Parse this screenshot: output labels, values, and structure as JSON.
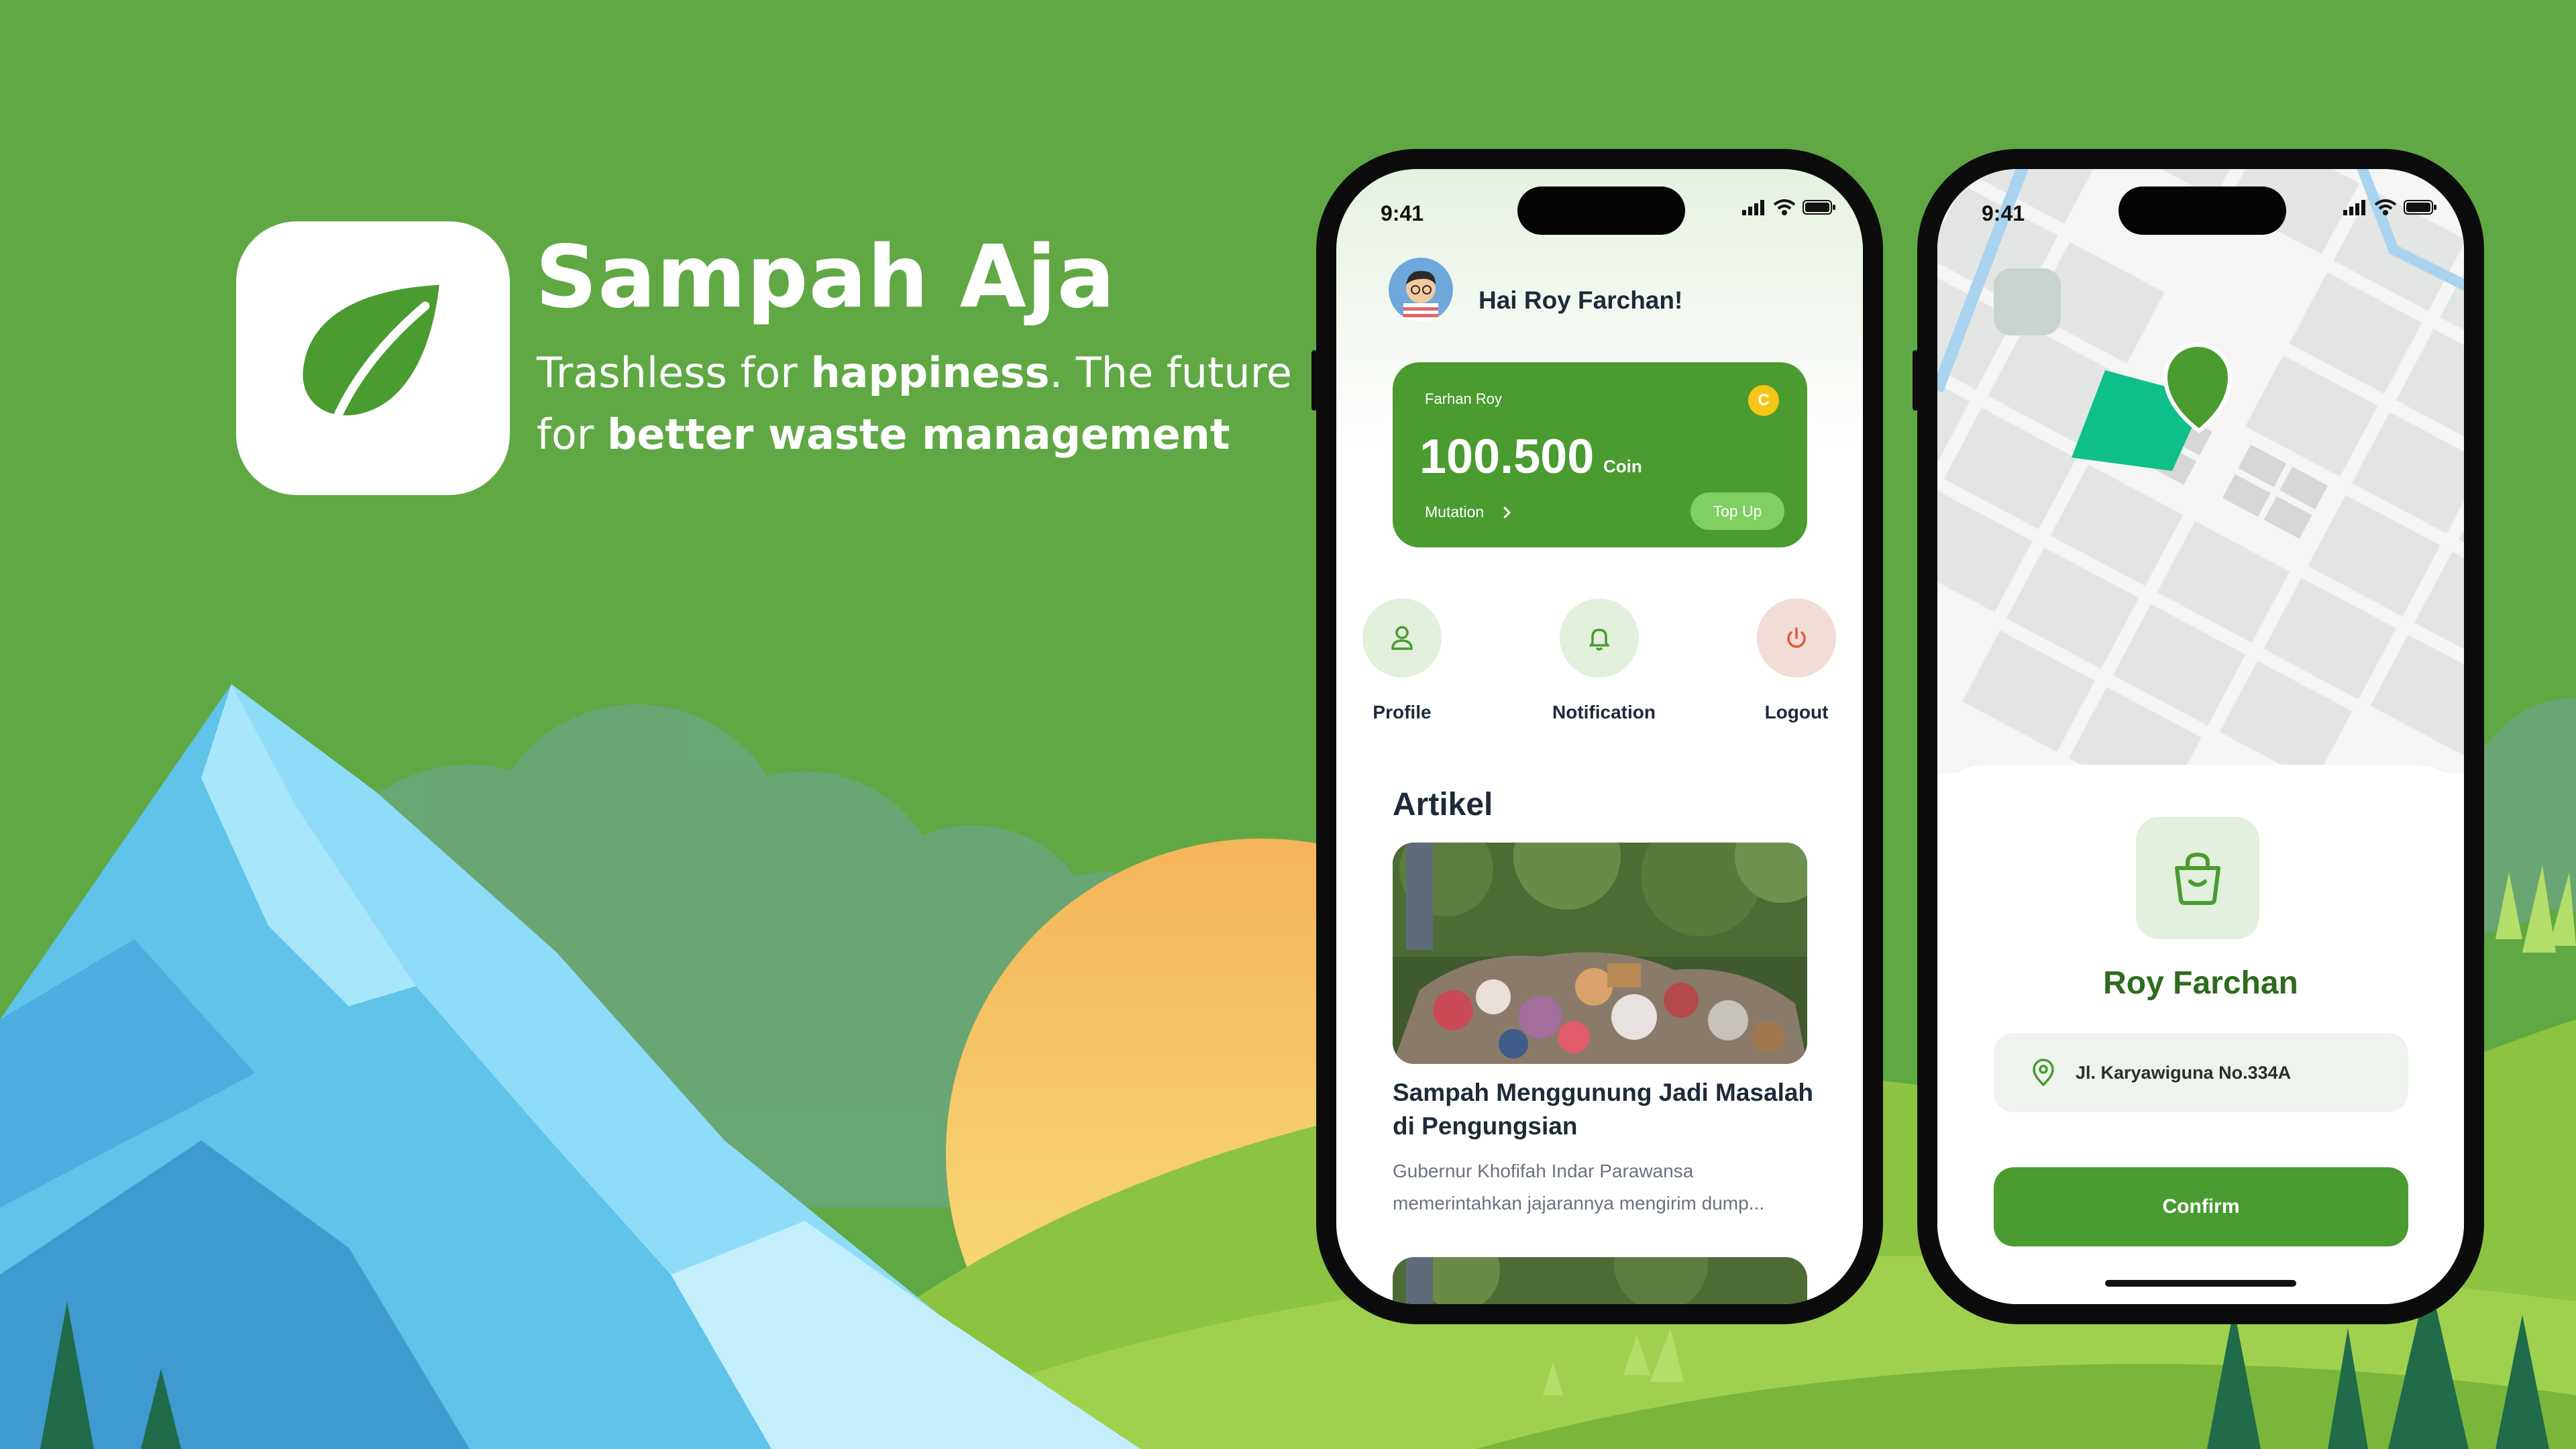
{
  "brand": {
    "title": "Sampah Aja",
    "tagline_1": "Trashless for ",
    "tagline_1_bold": "happiness",
    "tagline_2": ". The future for ",
    "tagline_2_bold": "better waste management",
    "icon": "leaf-icon"
  },
  "colors": {
    "background": "#60a844",
    "primary": "#4a9b30",
    "topup": "#7fcf62",
    "coin": "#f5c518",
    "logout": "#e05a3a",
    "map_area": "#0fbf8a"
  },
  "phone1": {
    "status_time": "9:41",
    "greeting": "Hai Roy Farchan!",
    "wallet": {
      "name": "Farhan Roy",
      "coin_symbol": "C",
      "amount": "100.500",
      "unit": "Coin",
      "mutation_label": "Mutation",
      "topup_label": "Top Up"
    },
    "quick_actions": [
      {
        "label": "Profile",
        "icon": "user-icon"
      },
      {
        "label": "Notification",
        "icon": "bell-icon"
      },
      {
        "label": "Logout",
        "icon": "power-icon"
      }
    ],
    "section_title": "Artikel",
    "article": {
      "title": "Sampah Menggunung Jadi Masalah di Pengungsian",
      "description": "Gubernur Khofifah Indar Parawansa memerintahkan jajarannya mengirim dump..."
    }
  },
  "phone2": {
    "status_time": "9:41",
    "name": "Roy Farchan",
    "address": "Jl. Karyawiguna No.334A",
    "confirm_label": "Confirm"
  }
}
